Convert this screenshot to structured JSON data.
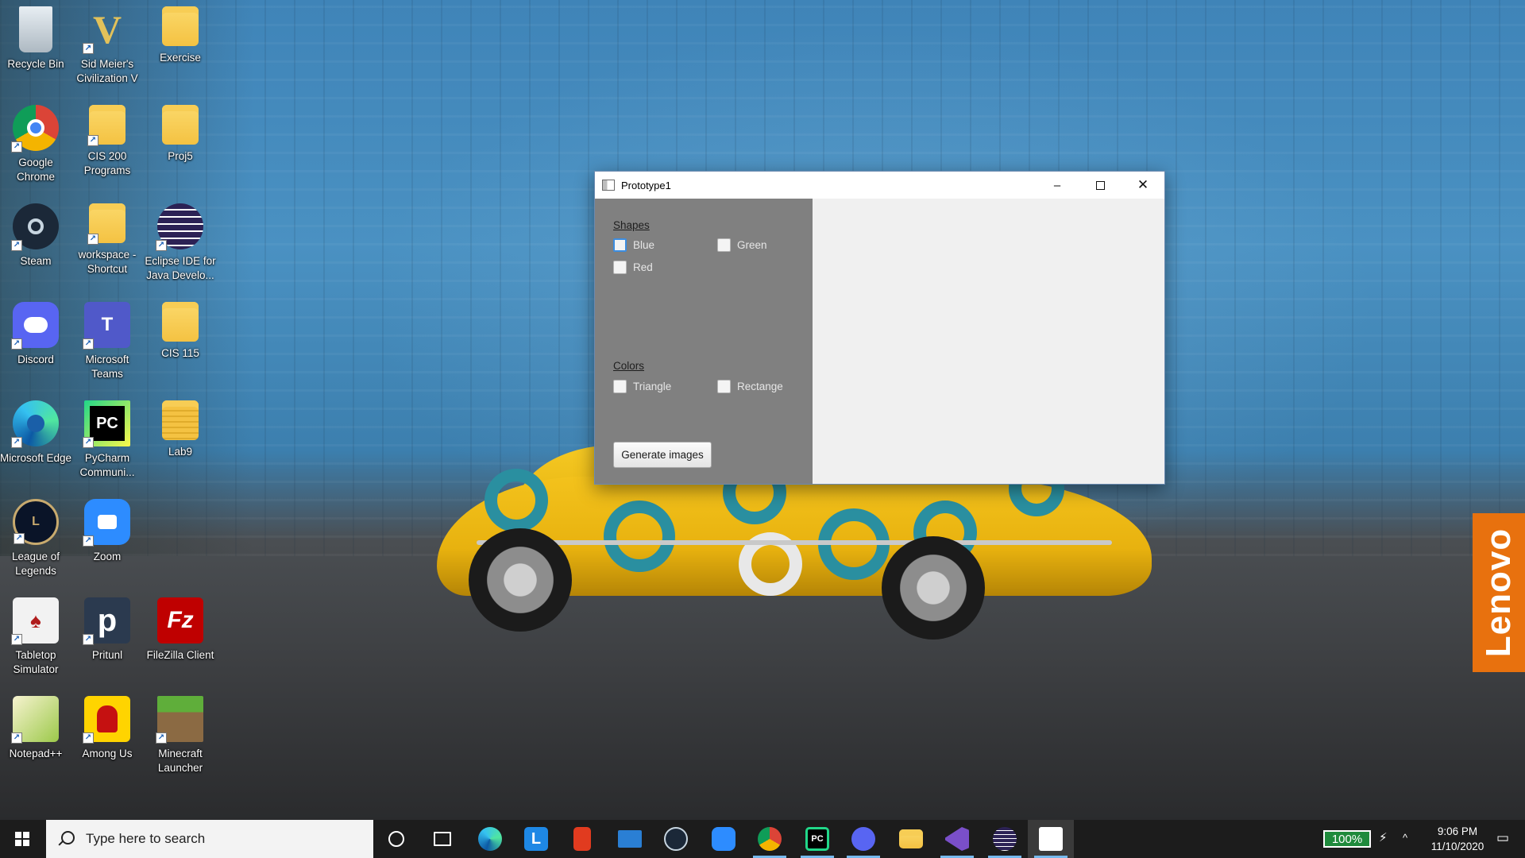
{
  "desktop": {
    "icons": [
      {
        "label": "Recycle Bin",
        "icon": "recycle-bin-icon"
      },
      {
        "label": "Sid Meier's Civilization V",
        "icon": "civilization-icon"
      },
      {
        "label": "Exercise",
        "icon": "folder-icon"
      },
      {
        "label": "Google Chrome",
        "icon": "chrome-icon"
      },
      {
        "label": "CIS 200 Programs",
        "icon": "folder-icon"
      },
      {
        "label": "Proj5",
        "icon": "folder-icon"
      },
      {
        "label": "Steam",
        "icon": "steam-icon"
      },
      {
        "label": "workspace - Shortcut",
        "icon": "folder-icon"
      },
      {
        "label": "Eclipse IDE for Java Develo...",
        "icon": "eclipse-icon"
      },
      {
        "label": "Discord",
        "icon": "discord-icon"
      },
      {
        "label": "Microsoft Teams",
        "icon": "teams-icon"
      },
      {
        "label": "CIS 115",
        "icon": "folder-icon"
      },
      {
        "label": "Microsoft Edge",
        "icon": "edge-icon"
      },
      {
        "label": "PyCharm Communi...",
        "icon": "pycharm-icon"
      },
      {
        "label": "Lab9",
        "icon": "zip-folder-icon"
      },
      {
        "label": "League of Legends",
        "icon": "league-of-legends-icon"
      },
      {
        "label": "Zoom",
        "icon": "zoom-icon"
      },
      {
        "label": "Tabletop Simulator",
        "icon": "tabletop-simulator-icon"
      },
      {
        "label": "Pritunl",
        "icon": "pritunl-icon"
      },
      {
        "label": "FileZilla Client",
        "icon": "filezilla-icon"
      },
      {
        "label": "Notepad++",
        "icon": "notepad-plus-plus-icon"
      },
      {
        "label": "Among Us",
        "icon": "among-us-icon"
      },
      {
        "label": "Minecraft Launcher",
        "icon": "minecraft-icon"
      }
    ],
    "glyphs": {
      "civ": "V",
      "pycharm": "PC",
      "teams": "T",
      "pritunl": "p",
      "filezilla": "Fz",
      "shortcut": "↗"
    },
    "lenovo": "Lenovo"
  },
  "window": {
    "title": "Prototype1",
    "min_glyph": "–",
    "close_glyph": "✕",
    "shapes_label": "Shapes",
    "shapes": [
      "Blue",
      "Green",
      "Red"
    ],
    "colors_label": "Colors",
    "colors": [
      "Triangle",
      "Rectange"
    ],
    "generate_label": "Generate images"
  },
  "taskbar": {
    "search_placeholder": "Type here to search",
    "apps": [
      {
        "icon": "cortana-icon"
      },
      {
        "icon": "task-view-icon"
      },
      {
        "icon": "edge-icon"
      },
      {
        "icon": "lenovo-vantage-icon",
        "glyph": "L"
      },
      {
        "icon": "office-icon"
      },
      {
        "icon": "mail-icon"
      },
      {
        "icon": "steam-icon"
      },
      {
        "icon": "zoom-icon"
      },
      {
        "icon": "chrome-icon"
      },
      {
        "icon": "pycharm-icon",
        "glyph": "PC"
      },
      {
        "icon": "discord-icon"
      },
      {
        "icon": "file-explorer-icon"
      },
      {
        "icon": "visual-studio-icon"
      },
      {
        "icon": "eclipse-icon"
      },
      {
        "icon": "java-icon"
      }
    ],
    "battery": "100%",
    "time": "9:06 PM",
    "date": "11/10/2020"
  },
  "colors": {
    "panel_gray": "#808080",
    "taskbar": "#1c1c1c",
    "battery_green": "#1f8a3c",
    "lenovo_orange": "#e8710e"
  }
}
